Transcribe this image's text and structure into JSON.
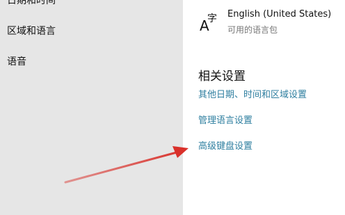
{
  "sidebar": {
    "items": [
      {
        "label": "日期和时间"
      },
      {
        "label": "区域和语言"
      },
      {
        "label": "语音"
      }
    ]
  },
  "language": {
    "icon": "language-icon",
    "icon_letter": "A",
    "icon_char": "字",
    "name": "English (United States)",
    "status": "可用的语言包"
  },
  "related": {
    "title": "相关设置",
    "links": [
      {
        "label": "其他日期、时间和区域设置"
      },
      {
        "label": "管理语言设置"
      },
      {
        "label": "高级键盘设置"
      }
    ]
  },
  "colors": {
    "link": "#2f7fa0",
    "sidebar_bg": "#e6e6e6",
    "arrow": "#d9302a"
  }
}
